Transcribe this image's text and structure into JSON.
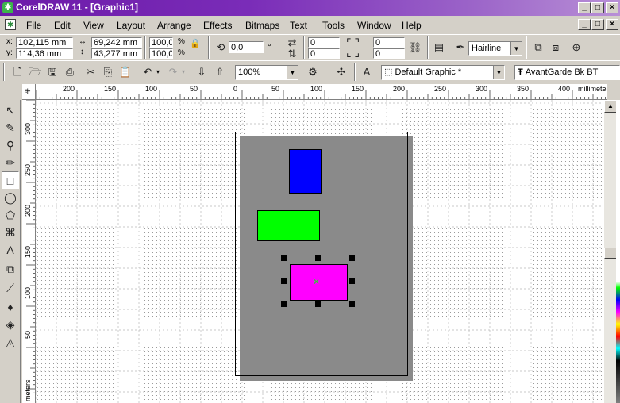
{
  "app": {
    "title": "CorelDRAW 11 - [Graphic1]",
    "window_buttons": [
      "_",
      "□",
      "×"
    ],
    "doc_buttons": [
      "_",
      "□",
      "×"
    ]
  },
  "menu": [
    "File",
    "Edit",
    "View",
    "Layout",
    "Arrange",
    "Effects",
    "Bitmaps",
    "Text",
    "Tools",
    "Window",
    "Help"
  ],
  "property_bar": {
    "x_label": "x:",
    "x_value": "102,115 mm",
    "y_label": "y:",
    "y_value": "114,36 mm",
    "width_value": "69,242 mm",
    "height_value": "43,277 mm",
    "scale_x": "100,0",
    "scale_y": "100,0",
    "percent": "%",
    "rotation": "0,0",
    "degree": "°",
    "corner_a": "0",
    "corner_b": "0",
    "corner_c": "0",
    "corner_d": "0",
    "outline": "Hairline"
  },
  "standard_bar": {
    "zoom": "100%",
    "style": "Default Graphic *",
    "font": "AvantGarde Bk BT"
  },
  "ruler": {
    "units": "millimeters",
    "h_ticks": [
      "200",
      "150",
      "100",
      "50",
      "0",
      "50",
      "100",
      "150",
      "200",
      "250",
      "300",
      "350",
      "400"
    ],
    "v_ticks": [
      "300",
      "250",
      "200",
      "150",
      "100",
      "50"
    ],
    "v_units": "meters"
  },
  "shapes": [
    {
      "name": "blue-rectangle",
      "color": "#0000ff"
    },
    {
      "name": "green-rectangle",
      "color": "#00ff00"
    },
    {
      "name": "magenta-rectangle",
      "color": "#ff00ff",
      "selected": true
    }
  ],
  "colors": {
    "title_gradient_start": "#6c1aa8",
    "selection_handle": "#000000",
    "center_marker": "#33cc33"
  },
  "icons": [
    "corel-app-icon",
    "pick-tool-icon",
    "shape-tool-icon",
    "zoom-tool-icon",
    "freehand-tool-icon",
    "rectangle-tool-icon",
    "ellipse-tool-icon",
    "polygon-tool-icon",
    "spiral-tool-icon",
    "text-tool-icon",
    "interactive-blend-icon",
    "eyedropper-icon",
    "outline-pen-icon",
    "fill-tool-icon",
    "interactive-fill-icon"
  ]
}
